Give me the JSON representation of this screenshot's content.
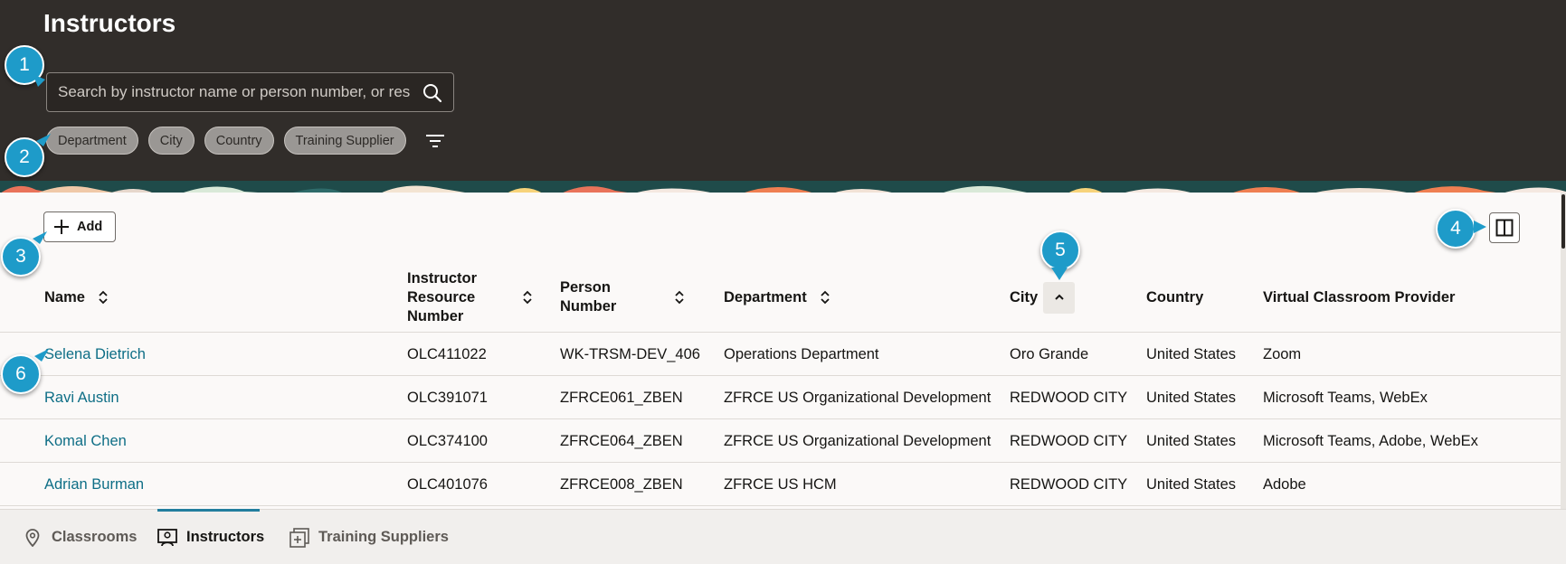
{
  "header": {
    "title": "Instructors",
    "search_placeholder": "Search by instructor name or person number, or resource number"
  },
  "filters": {
    "chips": [
      "Department",
      "City",
      "Country",
      "Training Supplier"
    ]
  },
  "toolbar": {
    "add_label": "Add"
  },
  "table": {
    "columns": [
      {
        "label": "Name",
        "sortable": true
      },
      {
        "label": "Instructor Resource Number",
        "sortable": true
      },
      {
        "label": "Person Number",
        "sortable": true
      },
      {
        "label": "Department",
        "sortable": true
      },
      {
        "label": "City",
        "sortable": true,
        "sorted": "ascending"
      },
      {
        "label": "Country",
        "sortable": false
      },
      {
        "label": "Virtual Classroom Provider",
        "sortable": false
      }
    ],
    "col_names": {
      "name": "Name",
      "irn_line1": "Instructor",
      "irn_line2": "Resource",
      "irn_line3": "Number",
      "pn_line1": "Person",
      "pn_line2": "Number",
      "department": "Department",
      "city": "City",
      "country": "Country",
      "vcp": "Virtual Classroom Provider"
    },
    "rows": [
      {
        "name": "Selena Dietrich",
        "irn": "OLC411022",
        "person_number": "WK-TRSM-DEV_406",
        "department": "Operations Department",
        "city": "Oro Grande",
        "country": "United States",
        "vcp": "Zoom"
      },
      {
        "name": "Ravi Austin",
        "irn": "OLC391071",
        "person_number": "ZFRCE061_ZBEN",
        "department": "ZFRCE US Organizational Development",
        "city": "REDWOOD CITY",
        "country": "United States",
        "vcp": "Microsoft Teams, WebEx"
      },
      {
        "name": "Komal Chen",
        "irn": "OLC374100",
        "person_number": "ZFRCE064_ZBEN",
        "department": "ZFRCE US Organizational Development",
        "city": "REDWOOD CITY",
        "country": "United States",
        "vcp": "Microsoft Teams, Adobe, WebEx"
      },
      {
        "name": "Adrian Burman",
        "irn": "OLC401076",
        "person_number": "ZFRCE008_ZBEN",
        "department": "ZFRCE US HCM",
        "city": "REDWOOD CITY",
        "country": "United States",
        "vcp": "Adobe"
      }
    ]
  },
  "bottom_nav": {
    "items": [
      {
        "label": "Classrooms",
        "icon": "location-pin-icon"
      },
      {
        "label": "Instructors",
        "icon": "instructor-icon",
        "active": true
      },
      {
        "label": "Training Suppliers",
        "icon": "add-suppliers-icon"
      }
    ]
  },
  "callouts": [
    "1",
    "2",
    "3",
    "4",
    "5",
    "6"
  ],
  "colors": {
    "header_bg": "#312d2a",
    "link": "#0e6e86",
    "callout": "#1e9bc9",
    "active_tab_underline": "#227e9e"
  }
}
